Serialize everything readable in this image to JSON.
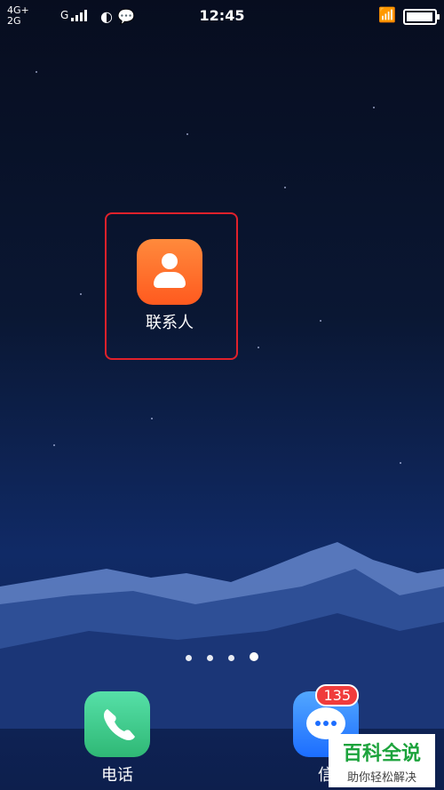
{
  "status_bar": {
    "network_top": "4G+",
    "network_bottom": "2G",
    "network_g": "G",
    "time": "12:45"
  },
  "home": {
    "contacts_label": "联系人",
    "page_count": 4,
    "active_page": 4
  },
  "dock": {
    "phone_label": "电话",
    "messages_label": "信",
    "messages_badge": "135"
  },
  "watermark": {
    "line1": "百科全说",
    "line2": "助你轻松解决"
  },
  "colors": {
    "highlight_border": "#e0212b",
    "contacts_icon": "#ff6a2a",
    "phone_icon": "#3fcf8c",
    "messages_icon": "#2f82ff",
    "badge": "#f03c3c"
  }
}
